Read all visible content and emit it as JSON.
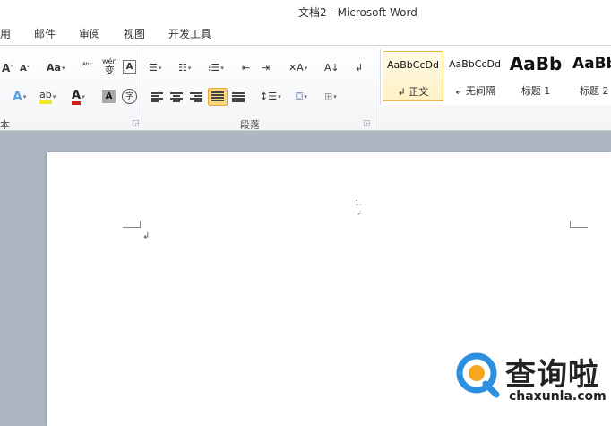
{
  "window": {
    "title": "文档2 - Microsoft Word"
  },
  "tabs": [
    "用",
    "邮件",
    "审阅",
    "视图",
    "开发工具"
  ],
  "ribbon": {
    "font_group": {
      "grow_font": "A",
      "shrink_font": "A",
      "change_case": "Aa",
      "phonetic": "wén",
      "phonetic_char": "变",
      "char_border": "A",
      "font_color_letter": "A",
      "char_shading": "A",
      "enclose_char": "字",
      "label": "本"
    },
    "paragraph_group": {
      "label": "段落"
    },
    "styles": [
      {
        "sample": "AaBbCcDd",
        "name": "↲ 正文",
        "selected": true
      },
      {
        "sample": "AaBbCcDd",
        "name": "↲ 无间隔",
        "selected": false
      },
      {
        "sample": "AaBb",
        "name": "标题 1",
        "selected": false
      },
      {
        "sample": "AaBb",
        "name": "标题 2",
        "selected": false
      }
    ]
  },
  "document": {
    "header_number": "1.",
    "header_mark": "↲",
    "paragraph_mark": "↲"
  },
  "watermark": {
    "chinese": "查询啦",
    "english": "chaxunla.com"
  },
  "colors": {
    "highlight": "#f0e62c",
    "font_color": "#d41c1c",
    "active_button": "#fbd67a",
    "workspace": "#aeb6c2"
  }
}
